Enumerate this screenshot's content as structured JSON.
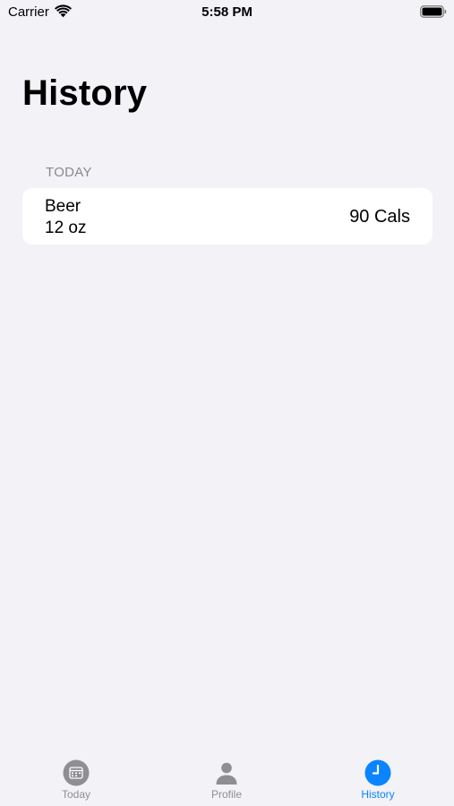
{
  "status_bar": {
    "carrier": "Carrier",
    "time": "5:58 PM"
  },
  "page": {
    "title": "History"
  },
  "sections": [
    {
      "header": "TODAY",
      "rows": [
        {
          "name": "Beer",
          "amount": "12 oz",
          "calories": "90 Cals"
        }
      ]
    }
  ],
  "tab_bar": {
    "tabs": [
      {
        "label": "Today",
        "icon": "calendar-icon",
        "active": false
      },
      {
        "label": "Profile",
        "icon": "person-icon",
        "active": false
      },
      {
        "label": "History",
        "icon": "clock-icon",
        "active": true
      }
    ]
  },
  "colors": {
    "background": "#f2f2f7",
    "card": "#ffffff",
    "accent": "#0a84ff",
    "inactive": "#8e8e93"
  }
}
